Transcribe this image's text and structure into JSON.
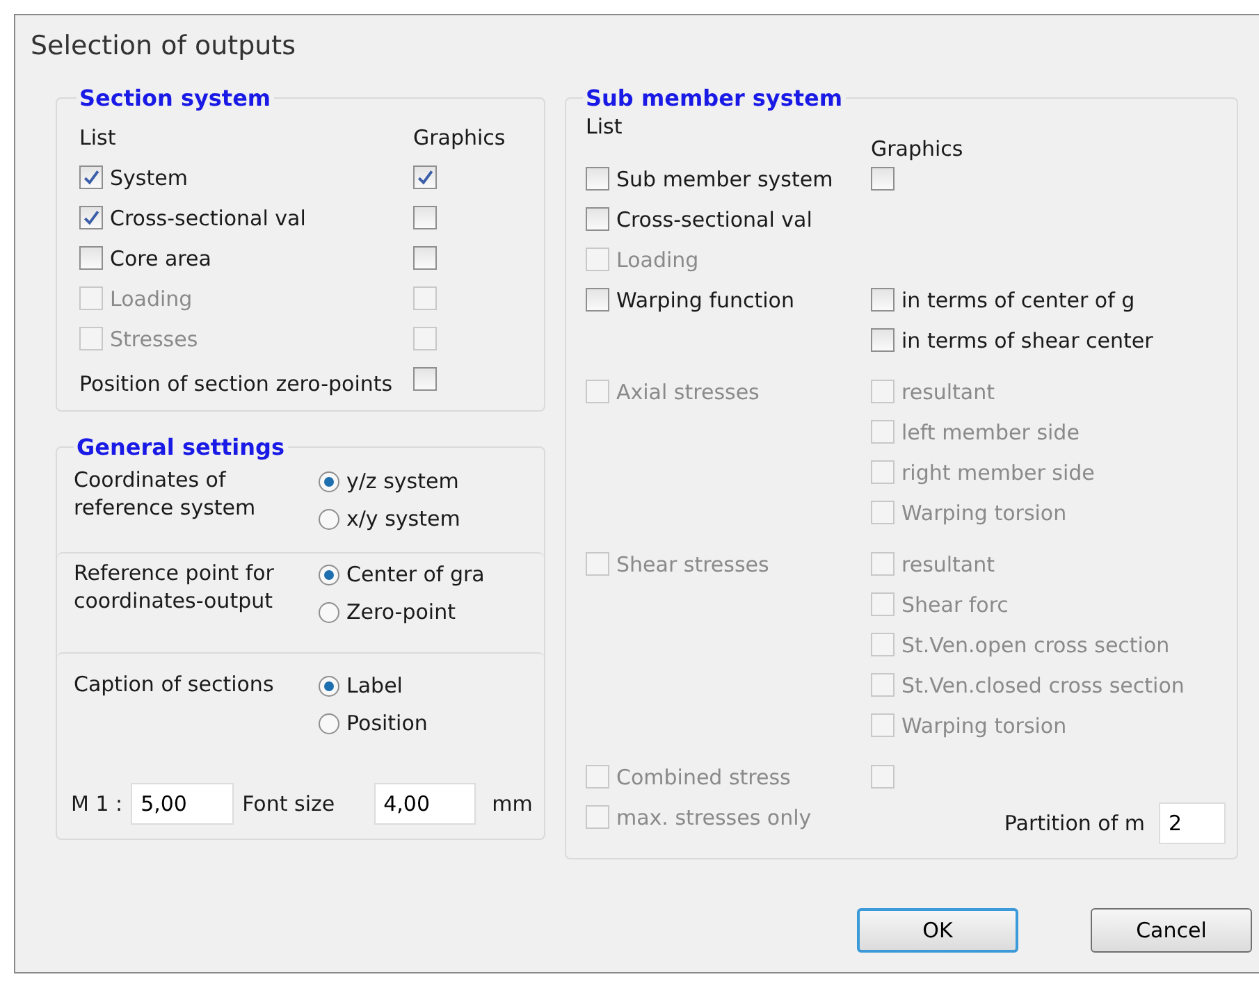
{
  "window": {
    "title": "Selection of outputs"
  },
  "section_system": {
    "title": "Section system",
    "list_header": "List",
    "graphics_header": "Graphics",
    "rows": [
      {
        "label": "System",
        "checked": true,
        "disabled": false,
        "graphics": {
          "checked": true,
          "disabled": false
        }
      },
      {
        "label": "Cross-sectional val",
        "checked": true,
        "disabled": false,
        "graphics": {
          "checked": false,
          "disabled": false
        }
      },
      {
        "label": "Core area",
        "checked": false,
        "disabled": false,
        "graphics": {
          "checked": false,
          "disabled": false
        }
      },
      {
        "label": "Loading",
        "checked": false,
        "disabled": true,
        "graphics": {
          "checked": false,
          "disabled": true
        }
      },
      {
        "label": "Stresses",
        "checked": false,
        "disabled": true,
        "graphics": {
          "checked": false,
          "disabled": true
        }
      }
    ],
    "zero_points": {
      "label": "Position of section zero-points",
      "checked": false,
      "disabled": false
    }
  },
  "general_settings": {
    "title": "General settings",
    "groups": [
      {
        "label": "Coordinates of reference system",
        "options": [
          {
            "label": "y/z system",
            "selected": true
          },
          {
            "label": "x/y system",
            "selected": false
          }
        ]
      },
      {
        "label": "Reference point for coordinates-output",
        "options": [
          {
            "label": "Center of gra",
            "selected": true
          },
          {
            "label": "Zero-point",
            "selected": false
          }
        ]
      },
      {
        "label": "Caption of sections",
        "options": [
          {
            "label": "Label",
            "selected": true
          },
          {
            "label": "Position",
            "selected": false
          }
        ]
      }
    ],
    "scale_label": "M 1 :",
    "scale_value": "5,00",
    "font_size_label": "Font size",
    "font_size_value": "4,00",
    "unit": "mm"
  },
  "sub_member_system": {
    "title": "Sub member system",
    "list_header": "List",
    "graphics_header": "Graphics",
    "rows": [
      {
        "label": "Sub member system",
        "checked": false,
        "disabled": false,
        "graphics": [
          {
            "checked": false,
            "disabled": false
          }
        ]
      },
      {
        "label": "Cross-sectional val",
        "checked": false,
        "disabled": false,
        "graphics": []
      },
      {
        "label": "Loading",
        "checked": false,
        "disabled": true,
        "graphics": []
      },
      {
        "label": "Warping function",
        "checked": false,
        "disabled": false,
        "graphics": [
          {
            "label": "in terms of center of g",
            "checked": false,
            "disabled": false
          },
          {
            "label": "in terms of shear center",
            "checked": false,
            "disabled": false
          }
        ]
      },
      {
        "label": "Axial stresses",
        "checked": false,
        "disabled": true,
        "graphics": [
          {
            "label": "resultant",
            "checked": false,
            "disabled": true
          },
          {
            "label": "left member side",
            "checked": false,
            "disabled": true
          },
          {
            "label": "right member side",
            "checked": false,
            "disabled": true
          },
          {
            "label": "Warping torsion",
            "checked": false,
            "disabled": true
          }
        ]
      },
      {
        "label": "Shear stresses",
        "checked": false,
        "disabled": true,
        "graphics": [
          {
            "label": "resultant",
            "checked": false,
            "disabled": true
          },
          {
            "label": "Shear forc",
            "checked": false,
            "disabled": true
          },
          {
            "label": "St.Ven.open cross section",
            "checked": false,
            "disabled": true
          },
          {
            "label": "St.Ven.closed cross section",
            "checked": false,
            "disabled": true
          },
          {
            "label": "Warping torsion",
            "checked": false,
            "disabled": true
          }
        ]
      },
      {
        "label": "Combined stress",
        "checked": false,
        "disabled": true,
        "graphics": [
          {
            "checked": false,
            "disabled": true
          }
        ]
      },
      {
        "label": "max. stresses only",
        "checked": false,
        "disabled": true,
        "graphics": []
      }
    ],
    "partition_label": "Partition of m",
    "partition_value": "2"
  },
  "buttons": [
    {
      "label": "OK",
      "default": true
    },
    {
      "label": "Cancel",
      "default": false
    }
  ]
}
